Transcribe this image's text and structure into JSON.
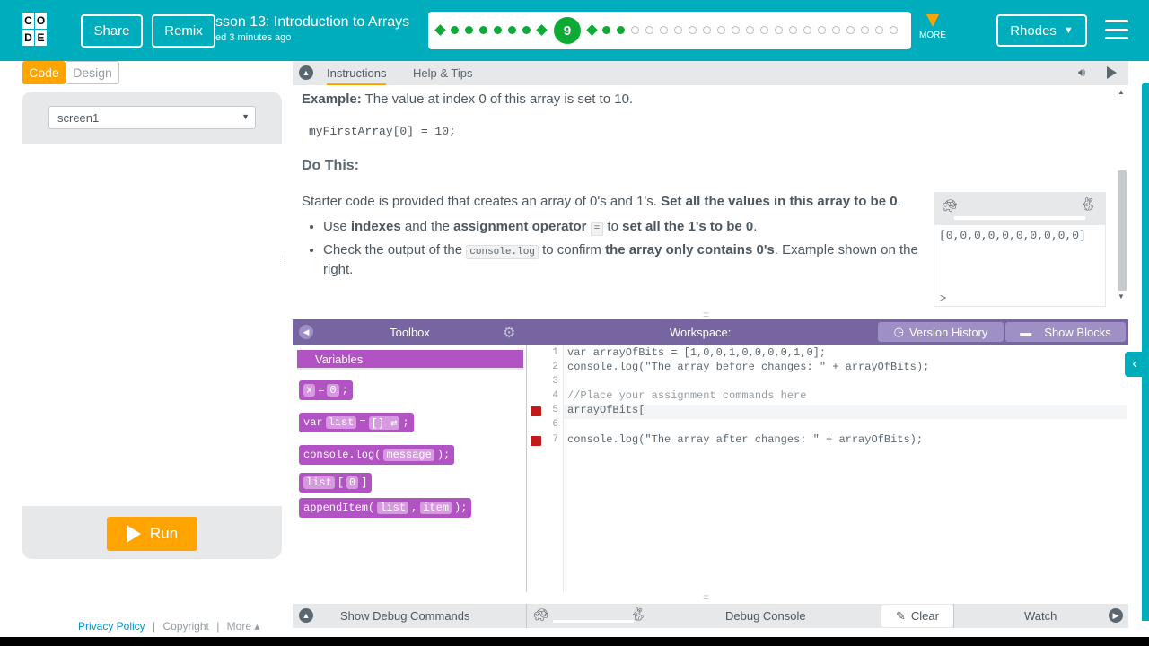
{
  "header": {
    "logo_letters": [
      "C",
      "O",
      "D",
      "E"
    ],
    "share_label": "Share",
    "remix_label": "Remix",
    "lesson_title": "sson 13: Introduction to Arrays",
    "lesson_subtitle": "ed 3 minutes ago",
    "current_level": "9",
    "more_label": "MORE",
    "user_label": "Rhodes",
    "accent": "#00adbc"
  },
  "left_panel": {
    "code_tab": "Code",
    "design_tab": "Design",
    "screen_select": "screen1",
    "run_label": "Run",
    "footer": {
      "privacy": "Privacy Policy",
      "sep1": "|",
      "copyright": "Copyright",
      "sep2": "|",
      "more": "More ▴"
    }
  },
  "instructions": {
    "tab_instructions": "Instructions",
    "tab_help": "Help & Tips",
    "example_label": "Example:",
    "example_text": " The value at index 0 of this array is set to 10.",
    "example_code": "myFirstArray[0] = 10;",
    "do_this": "Do This:",
    "starter_text": "Starter code is provided that creates an array of 0's and 1's. ",
    "starter_bold": "Set all the values in this array to be 0",
    "starter_end": ".",
    "bullet1": {
      "p1": "Use ",
      "b1": "indexes",
      "p2": " and the ",
      "b2": "assignment operator",
      "p3": " ",
      "code": "=",
      "p4": " to ",
      "b3": "set all the 1's to be 0",
      "p5": "."
    },
    "bullet2": {
      "p1": "Check the output of the ",
      "code": "console.log",
      "p2": " to confirm ",
      "b1": "the array only contains 0's",
      "p3": ". Example shown on the right."
    },
    "preview_output": "[0,0,0,0,0,0,0,0,0,0]",
    "preview_prompt": ">"
  },
  "toolbox": {
    "title": "Toolbox",
    "category": "Variables",
    "blocks": {
      "b1_var": "x",
      "b1_eq": "=",
      "b1_val": "0",
      "b1_end": ";",
      "b2_kw": "var",
      "b2_name": "list",
      "b2_eq": "=",
      "b2_val": "[] ⇄",
      "b2_end": ";",
      "b3_fn": "console.log(",
      "b3_arg": "message",
      "b3_end": ");",
      "b4_name": "list",
      "b4_idx": "0",
      "b5_fn": "appendItem(",
      "b5_a1": "list",
      "b5_sep": ",",
      "b5_a2": "item",
      "b5_end": ");"
    }
  },
  "workspace": {
    "title": "Workspace:",
    "version_history": "Version History",
    "show_blocks": "Show Blocks",
    "line_numbers": [
      "1",
      "2",
      "3",
      "4",
      "5",
      "6",
      "7"
    ],
    "lines": {
      "l1": "var arrayOfBits = [1,0,0,1,0,0,0,0,1,0];",
      "l2": "console.log(\"The array before changes: \" + arrayOfBits);",
      "l4": "//Place your assignment commands here",
      "l5": "arrayOfBits[",
      "l7": "console.log(\"The array after changes: \" + arrayOfBits);"
    }
  },
  "debug": {
    "show_debug": "Show Debug Commands",
    "console": "Debug Console",
    "clear": "Clear",
    "watch": "Watch"
  }
}
